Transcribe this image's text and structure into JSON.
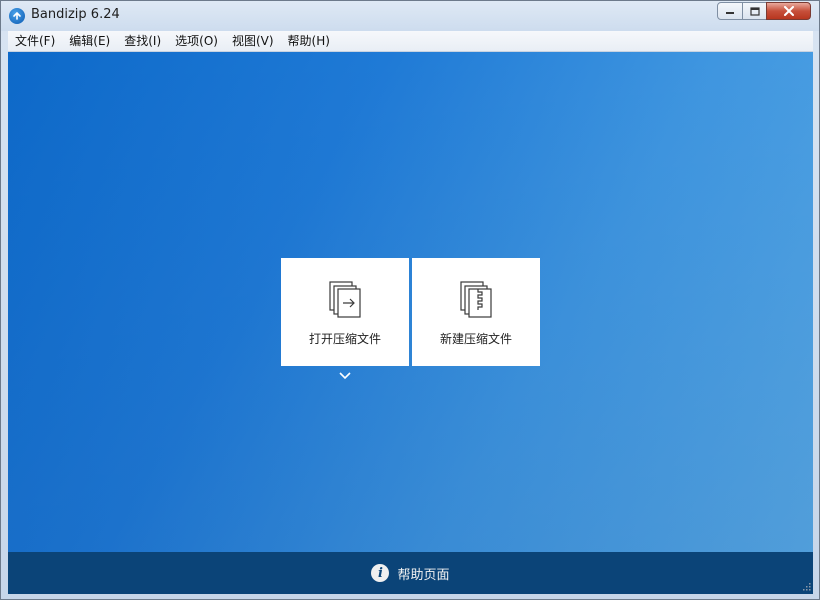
{
  "window": {
    "title": "Bandizip 6.24",
    "icon": "bandizip-logo-icon",
    "controls": {
      "minimize": "minimize-icon",
      "maximize": "maximize-icon",
      "close": "close-icon"
    }
  },
  "menubar": {
    "items": [
      {
        "label": "文件(F)"
      },
      {
        "label": "编辑(E)"
      },
      {
        "label": "查找(I)"
      },
      {
        "label": "选项(O)"
      },
      {
        "label": "视图(V)"
      },
      {
        "label": "帮助(H)"
      }
    ]
  },
  "main": {
    "open_archive": {
      "label": "打开压缩文件",
      "icon": "open-archive-icon"
    },
    "new_archive": {
      "label": "新建压缩文件",
      "icon": "new-archive-icon"
    },
    "dropdown_icon": "chevron-down-icon"
  },
  "footer": {
    "help_label": "帮助页面",
    "help_icon": "info-icon"
  },
  "colors": {
    "accent_blue": "#1f7ad6",
    "footer_bg": "#0b4478",
    "close_red": "#c7503b"
  }
}
